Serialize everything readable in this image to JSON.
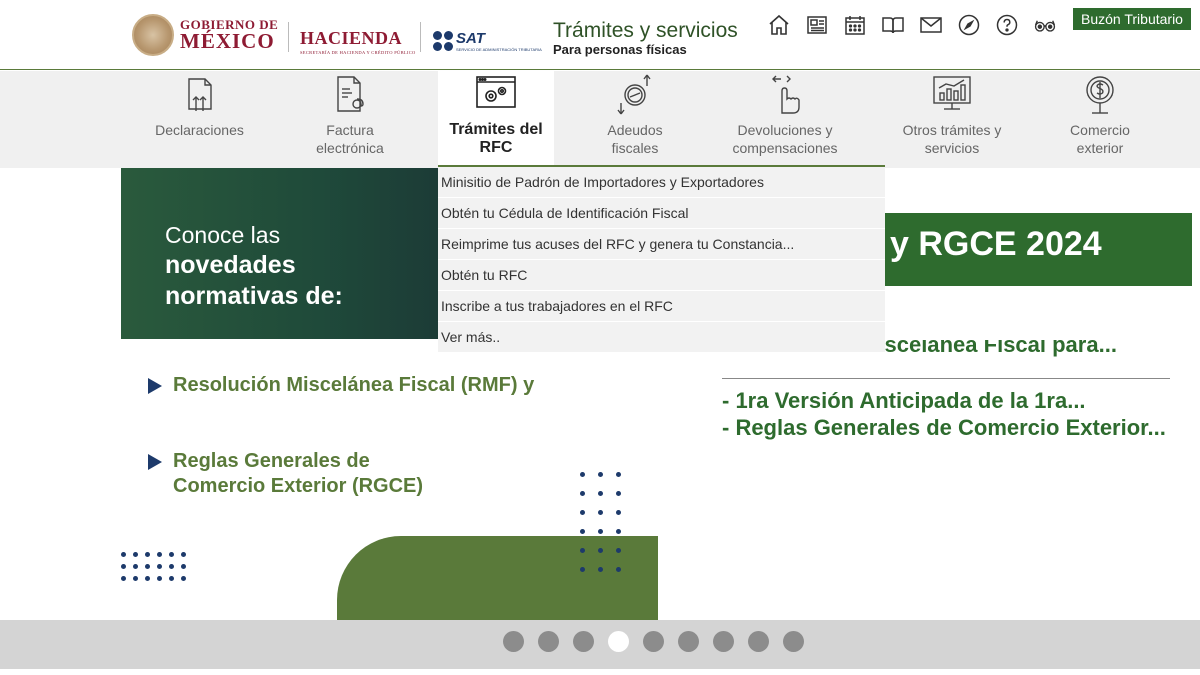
{
  "header": {
    "gobierno_line1": "GOBIERNO DE",
    "gobierno_line2": "MÉXICO",
    "hacienda": "HACIENDA",
    "hacienda_sub": "SECRETARÍA DE HACIENDA Y CRÉDITO PÚBLICO",
    "sat": "SAT",
    "sat_sub": "SERVICIO DE ADMINISTRACIÓN TRIBUTARIA",
    "title": "Trámites y servicios",
    "subtitle": "Para personas físicas",
    "buzon": "Buzón Tributario",
    "icons": [
      "home-icon",
      "news-icon",
      "calendar-icon",
      "book-icon",
      "mail-icon",
      "compass-icon",
      "help-icon",
      "accessibility-icon"
    ]
  },
  "nav": {
    "items": [
      {
        "label": "Declaraciones",
        "icon": "declaraciones-icon"
      },
      {
        "label": "Factura electrónica",
        "icon": "factura-icon"
      },
      {
        "label": "Trámites del RFC",
        "icon": "rfc-icon",
        "active": true
      },
      {
        "label": "Adeudos fiscales",
        "icon": "adeudos-icon"
      },
      {
        "label": "Devoluciones y compensaciones",
        "icon": "devoluciones-icon"
      },
      {
        "label": "Otros trámites y servicios",
        "icon": "otros-tramites-icon"
      },
      {
        "label": "Comercio exterior",
        "icon": "comercio-exterior-icon"
      }
    ]
  },
  "dropdown": {
    "items": [
      "Minisitio de Padrón de Importadores y Exportadores",
      "Obtén tu Cédula de Identificación Fiscal",
      "Reimprime tus acuses del RFC y genera tu Constancia...",
      "Obtén tu RFC",
      "Inscribe a tus trabajadores en el RFC",
      "Ver más.."
    ]
  },
  "banner": {
    "hero_line1": "Conoce las",
    "hero_line2": "novedades",
    "hero_line3": "normativas de:",
    "rgce_title": "y RGCE 2024",
    "right_partial": "- Resolución Miscelánea Fiscal para...",
    "right_item1": "- 1ra Versión Anticipada de la 1ra...",
    "right_item2": "- Reglas Generales de Comercio Exterior...",
    "bullet1": "Resolución Miscelánea Fiscal (RMF) y",
    "bullet2_line1": "Reglas Generales de",
    "bullet2_line2": "Comercio Exterior (RGCE)"
  },
  "carousel": {
    "count": 9,
    "active_index": 3
  },
  "colors": {
    "primary_green": "#2e6b2e",
    "olive": "#5a7a3a",
    "navy": "#1d3a6b",
    "maroon": "#8e1b33"
  }
}
